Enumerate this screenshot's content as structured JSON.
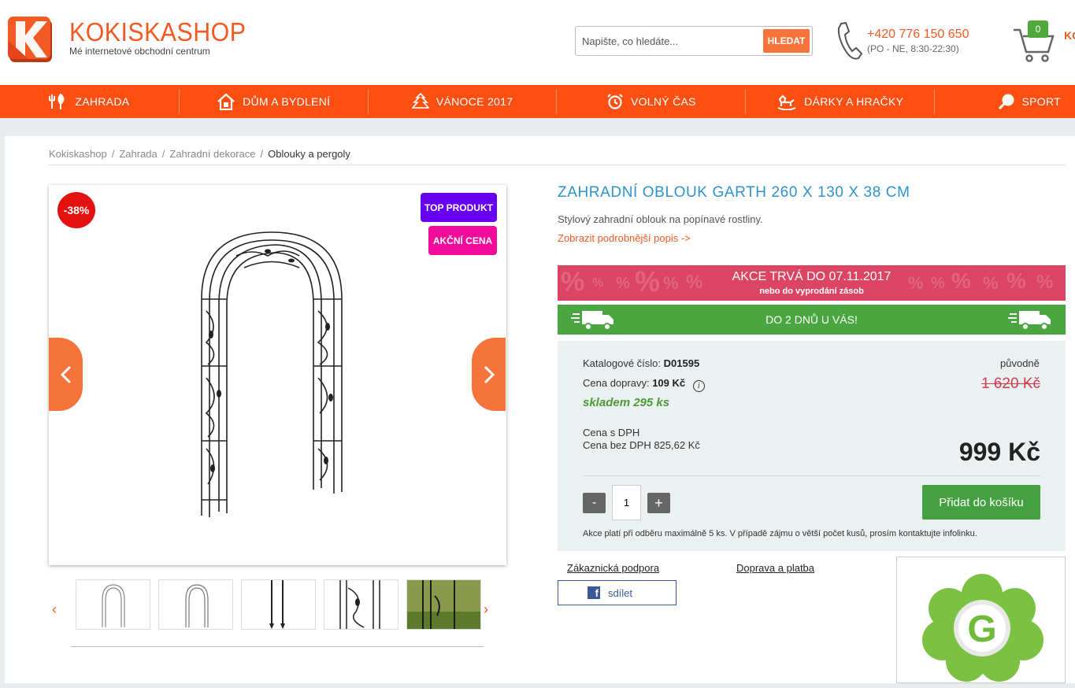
{
  "header": {
    "shop_name": "KOKISKASHOP",
    "tagline": "Mé internetové obchodní centrum",
    "search": {
      "placeholder": "Napište, co hledáte...",
      "button": "HLEDAT"
    },
    "phone": "+420 776 150 650",
    "hours": "(PO - NE, 8:30-22:30)",
    "cart_count": "0",
    "cart_label": "KO"
  },
  "nav": [
    {
      "label": "ZAHRADA",
      "icon": "garden-tools-icon"
    },
    {
      "label": "DŮM A BYDLENÍ",
      "icon": "house-icon"
    },
    {
      "label": "VÁNOCE 2017",
      "icon": "christmas-tree-icon"
    },
    {
      "label": "VOLNÝ ČAS",
      "icon": "alarm-clock-icon"
    },
    {
      "label": "DÁRKY A HRAČKY",
      "icon": "rocking-horse-icon"
    },
    {
      "label": "SPORT",
      "icon": "ping-pong-icon"
    }
  ],
  "breadcrumb": [
    "Kokiskashop",
    "Zahrada",
    "Zahradní dekorace",
    "Oblouky a pergoly"
  ],
  "gallery": {
    "discount": "-38%",
    "tag_top": "TOP PRODUKT",
    "tag_sale": "AKČNÍ CENA"
  },
  "product": {
    "title": "ZAHRADNÍ OBLOUK GARTH 260 X 130 X 38 CM",
    "subtitle": "Stylový zahradní oblouk na popínavé rostliny.",
    "more_link": "Zobrazit podrobnější popis ->",
    "promo_title": "AKCE TRVÁ DO 07.11.2017",
    "promo_sub": "nebo do vyprodání zásob",
    "shipping_banner": "DO 2 DNŮ U VÁS!",
    "catalog_label": "Katalogové číslo:",
    "catalog_no": "D01595",
    "shipping_label": "Cena dopravy:",
    "shipping_price": "109 Kč",
    "stock": "skladem 295 ks",
    "original_label": "původně",
    "original_price": "1 620 Kč",
    "vat_incl": "Cena s DPH",
    "vat_excl": "Cena bez DPH 825,62 Kč",
    "price": "999 Kč",
    "qty_minus": "-",
    "qty": "1",
    "qty_plus": "+",
    "add_to_cart": "Přidat do košíku",
    "limit_note": "Akce platí při odběru maximálně 5 ks. V případě zájmu o větší počet kusů, prosím kontaktujte infolinku.",
    "support_link": "Zákaznická podpora",
    "delivery_link": "Doprava a platba",
    "share": "sdílet"
  },
  "colors": {
    "brand_orange": "#fe4f12",
    "title_blue": "#2f92d0",
    "promo_red": "#dc4464",
    "ship_green": "#49a640",
    "button_green": "#44a040"
  }
}
